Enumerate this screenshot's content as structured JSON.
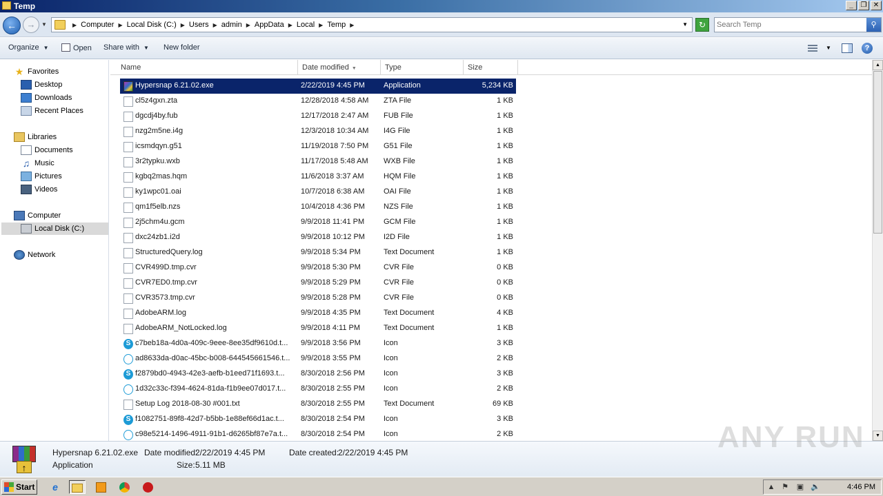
{
  "window": {
    "title": "Temp",
    "buttons": [
      "_",
      "❐",
      "✕"
    ]
  },
  "address": {
    "breadcrumbs": [
      "Computer",
      "Local Disk (C:)",
      "Users",
      "admin",
      "AppData",
      "Local",
      "Temp"
    ],
    "search_placeholder": "Search Temp"
  },
  "toolbar": {
    "organize": "Organize",
    "open": "Open",
    "share_with": "Share with",
    "new_folder": "New folder"
  },
  "nav": {
    "favorites": "Favorites",
    "desktop": "Desktop",
    "downloads": "Downloads",
    "recent_places": "Recent Places",
    "libraries": "Libraries",
    "documents": "Documents",
    "music": "Music",
    "pictures": "Pictures",
    "videos": "Videos",
    "computer": "Computer",
    "local_disk": "Local Disk (C:)",
    "network": "Network"
  },
  "columns": {
    "name": "Name",
    "date_modified": "Date modified",
    "type": "Type",
    "size": "Size"
  },
  "files": [
    {
      "name": "Hypersnap 6.21.02.exe",
      "date": "2/22/2019 4:45 PM",
      "type": "Application",
      "size": "5,234 KB",
      "icon": "app-icon",
      "selected": true
    },
    {
      "name": "cl5z4gxn.zta",
      "date": "12/28/2018 4:58 AM",
      "type": "ZTA File",
      "size": "1 KB",
      "icon": "file-icon"
    },
    {
      "name": "dgcdj4by.fub",
      "date": "12/17/2018 2:47 AM",
      "type": "FUB File",
      "size": "1 KB",
      "icon": "file-icon"
    },
    {
      "name": "nzg2m5ne.i4g",
      "date": "12/3/2018 10:34 AM",
      "type": "I4G File",
      "size": "1 KB",
      "icon": "file-icon"
    },
    {
      "name": "icsmdqyn.g51",
      "date": "11/19/2018 7:50 PM",
      "type": "G51 File",
      "size": "1 KB",
      "icon": "file-icon"
    },
    {
      "name": "3r2typku.wxb",
      "date": "11/17/2018 5:48 AM",
      "type": "WXB File",
      "size": "1 KB",
      "icon": "file-icon"
    },
    {
      "name": "kgbq2mas.hqm",
      "date": "11/6/2018 3:37 AM",
      "type": "HQM File",
      "size": "1 KB",
      "icon": "file-icon"
    },
    {
      "name": "ky1wpc01.oai",
      "date": "10/7/2018 6:38 AM",
      "type": "OAI File",
      "size": "1 KB",
      "icon": "file-icon"
    },
    {
      "name": "qm1f5elb.nzs",
      "date": "10/4/2018 4:36 PM",
      "type": "NZS File",
      "size": "1 KB",
      "icon": "file-icon"
    },
    {
      "name": "2j5chm4u.gcm",
      "date": "9/9/2018 11:41 PM",
      "type": "GCM File",
      "size": "1 KB",
      "icon": "file-icon"
    },
    {
      "name": "dxc24zb1.i2d",
      "date": "9/9/2018 10:12 PM",
      "type": "I2D File",
      "size": "1 KB",
      "icon": "file-icon"
    },
    {
      "name": "StructuredQuery.log",
      "date": "9/9/2018 5:34 PM",
      "type": "Text Document",
      "size": "1 KB",
      "icon": "text-file-icon"
    },
    {
      "name": "CVR499D.tmp.cvr",
      "date": "9/9/2018 5:30 PM",
      "type": "CVR File",
      "size": "0 KB",
      "icon": "file-icon"
    },
    {
      "name": "CVR7ED0.tmp.cvr",
      "date": "9/9/2018 5:29 PM",
      "type": "CVR File",
      "size": "0 KB",
      "icon": "file-icon"
    },
    {
      "name": "CVR3573.tmp.cvr",
      "date": "9/9/2018 5:28 PM",
      "type": "CVR File",
      "size": "0 KB",
      "icon": "file-icon"
    },
    {
      "name": "AdobeARM.log",
      "date": "9/9/2018 4:35 PM",
      "type": "Text Document",
      "size": "4 KB",
      "icon": "text-file-icon"
    },
    {
      "name": "AdobeARM_NotLocked.log",
      "date": "9/9/2018 4:11 PM",
      "type": "Text Document",
      "size": "1 KB",
      "icon": "text-file-icon"
    },
    {
      "name": "c7beb18a-4d0a-409c-9eee-8ee35df9610d.t...",
      "date": "9/9/2018 3:56 PM",
      "type": "Icon",
      "size": "3 KB",
      "icon": "skype-icon"
    },
    {
      "name": "ad8633da-d0ac-45bc-b008-644545661546.t...",
      "date": "9/9/2018 3:55 PM",
      "type": "Icon",
      "size": "2 KB",
      "icon": "skype-outline-icon"
    },
    {
      "name": "f2879bd0-4943-42e3-aefb-b1eed71f1693.t...",
      "date": "8/30/2018 2:56 PM",
      "type": "Icon",
      "size": "3 KB",
      "icon": "skype-icon"
    },
    {
      "name": "1d32c33c-f394-4624-81da-f1b9ee07d017.t...",
      "date": "8/30/2018 2:55 PM",
      "type": "Icon",
      "size": "2 KB",
      "icon": "skype-outline-icon"
    },
    {
      "name": "Setup Log 2018-08-30 #001.txt",
      "date": "8/30/2018 2:55 PM",
      "type": "Text Document",
      "size": "69 KB",
      "icon": "text-file-icon"
    },
    {
      "name": "f1082751-89f8-42d7-b5bb-1e88ef66d1ac.t...",
      "date": "8/30/2018 2:54 PM",
      "type": "Icon",
      "size": "3 KB",
      "icon": "skype-icon"
    },
    {
      "name": "c98e5214-1496-4911-91b1-d6265bf87e7a.t...",
      "date": "8/30/2018 2:54 PM",
      "type": "Icon",
      "size": "2 KB",
      "icon": "skype-outline-icon"
    }
  ],
  "details": {
    "name": "Hypersnap 6.21.02.exe",
    "type": "Application",
    "date_modified_label": "Date modified:",
    "date_modified": "2/22/2019 4:45 PM",
    "date_created_label": "Date created:",
    "date_created": "2/22/2019 4:45 PM",
    "size_label": "Size:",
    "size": "5.11 MB"
  },
  "watermark": "ANY RUN",
  "taskbar": {
    "start": "Start",
    "clock": "4:46 PM"
  }
}
